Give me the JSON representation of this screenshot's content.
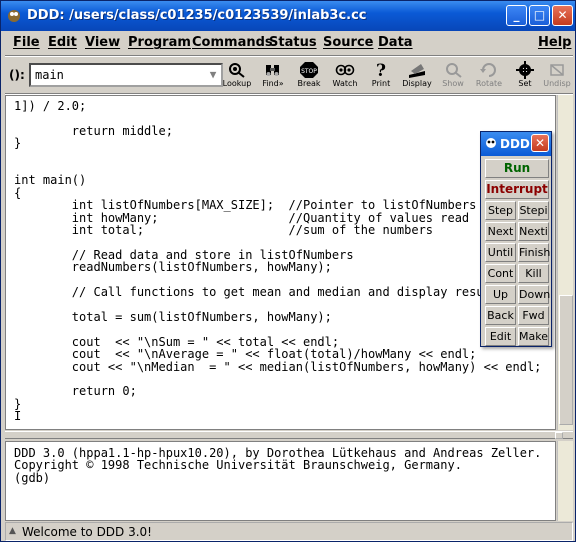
{
  "window": {
    "title": "DDD: /users/class/c01235/c0123539/inlab3c.cc",
    "buttons": {
      "minimize": "_",
      "maximize": "□",
      "close": "✕"
    }
  },
  "menu": [
    "File",
    "Edit",
    "View",
    "Program",
    "Commands",
    "Status",
    "Source",
    "Data",
    "Help"
  ],
  "toolbar": {
    "arg_label": "():",
    "arg_value": "main",
    "tools": [
      {
        "label": "Lookup",
        "icon": "lookup-icon",
        "enabled": true
      },
      {
        "label": "Find»",
        "icon": "find-icon",
        "enabled": true
      },
      {
        "label": "Break",
        "icon": "break-icon",
        "enabled": true
      },
      {
        "label": "Watch",
        "icon": "watch-icon",
        "enabled": true
      },
      {
        "label": "Print",
        "icon": "print-icon",
        "enabled": true
      },
      {
        "label": "Display",
        "icon": "display-icon",
        "enabled": true
      },
      {
        "label": "Show",
        "icon": "show-icon",
        "enabled": false
      },
      {
        "label": "Rotate",
        "icon": "rotate-icon",
        "enabled": false
      },
      {
        "label": "Set",
        "icon": "set-icon",
        "enabled": true
      },
      {
        "label": "Undisp",
        "icon": "undisp-icon",
        "enabled": false
      }
    ]
  },
  "source": {
    "lines": [
      "1]) / 2.0;",
      "",
      "        return middle;",
      "}",
      "",
      "",
      "int main()",
      "{",
      "        int listOfNumbers[MAX_SIZE];  //Pointer to listOfNumbers to ho",
      "        int howMany;                  //Quantity of values read",
      "        int total;                    //sum of the numbers",
      "",
      "        // Read data and store in listOfNumbers",
      "        readNumbers(listOfNumbers, howMany);",
      "",
      "        // Call functions to get mean and median and display results.",
      "",
      "        total = sum(listOfNumbers, howMany);",
      "",
      "        cout  << \"\\nSum = \" << total << endl;",
      "        cout  << \"\\nAverage = \" << float(total)/howMany << endl;",
      "        cout << \"\\nMedian  = \" << median(listOfNumbers, howMany) << endl;",
      "",
      "        return 0;",
      "}",
      "I"
    ]
  },
  "console": {
    "lines": [
      "DDD 3.0 (hppa1.1-hp-hpux10.20), by Dorothea Lütkehaus and Andreas Zeller.",
      "Copyright © 1998 Technische Universität Braunschweig, Germany.",
      "(gdb)"
    ]
  },
  "status": {
    "text": "Welcome to DDD 3.0!"
  },
  "panel": {
    "title": "DDD",
    "run": "Run",
    "interrupt": "Interrupt",
    "run_color": "#006400",
    "interrupt_color": "#8b0000",
    "pairs": [
      [
        "Step",
        "Stepi"
      ],
      [
        "Next",
        "Nexti"
      ],
      [
        "Until",
        "Finish"
      ],
      [
        "Cont",
        "Kill"
      ],
      [
        "Up",
        "Down"
      ],
      [
        "Back",
        "Fwd"
      ],
      [
        "Edit",
        "Make"
      ]
    ]
  }
}
